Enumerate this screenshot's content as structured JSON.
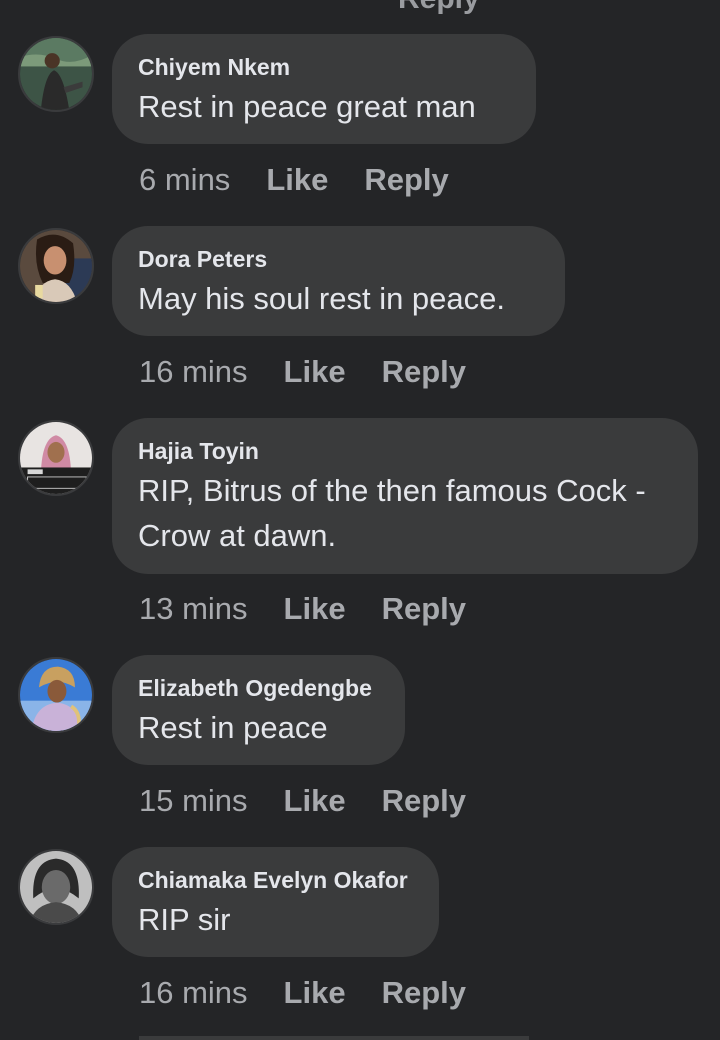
{
  "top_cut_label": "Reply",
  "comments": [
    {
      "name": "Chiyem Nkem",
      "text": "Rest in peace great man",
      "time": "6 mins",
      "like": "Like",
      "reply": "Reply"
    },
    {
      "name": "Dora Peters",
      "text": "May his soul rest in peace.",
      "time": "16 mins",
      "like": "Like",
      "reply": "Reply"
    },
    {
      "name": "Hajia Toyin",
      "text": "RIP, Bitrus of the then famous Cock - Crow at dawn.",
      "time": "13 mins",
      "like": "Like",
      "reply": "Reply"
    },
    {
      "name": "Elizabeth Ogedengbe",
      "text": "Rest in peace",
      "time": "15 mins",
      "like": "Like",
      "reply": "Reply"
    },
    {
      "name": "Chiamaka Evelyn Okafor",
      "text": "RIP sir",
      "time": "16 mins",
      "like": "Like",
      "reply": "Reply"
    }
  ]
}
